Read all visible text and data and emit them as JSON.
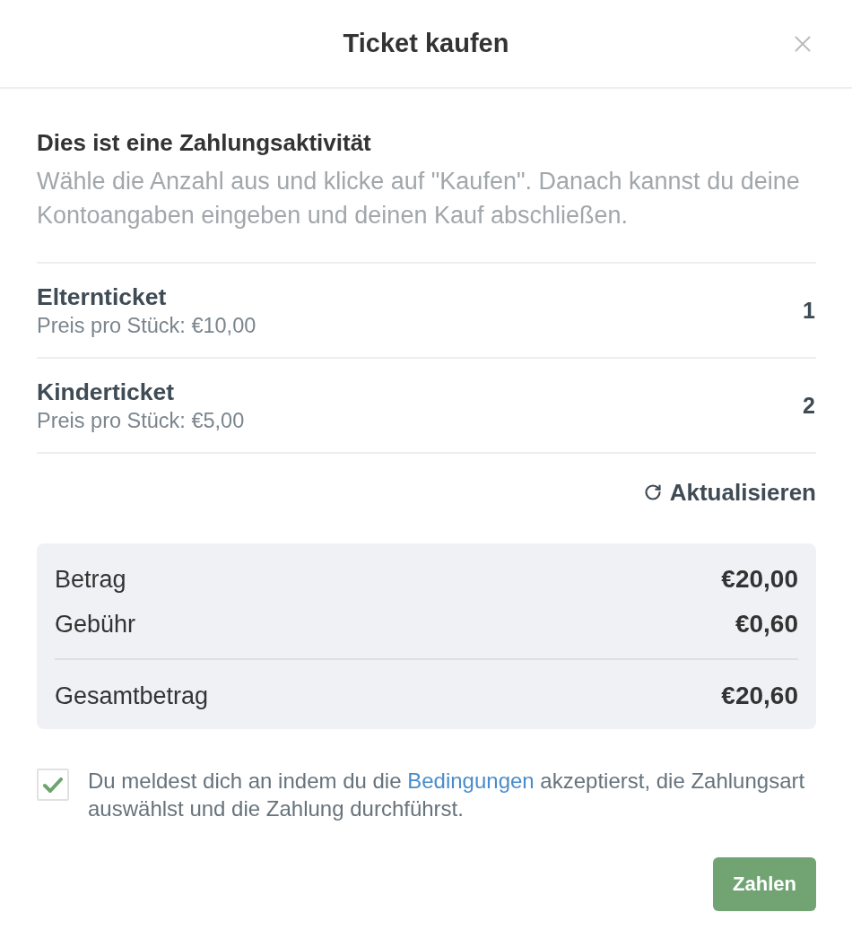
{
  "dialog": {
    "title": "Ticket kaufen"
  },
  "intro": {
    "heading": "Dies ist eine Zahlungsaktivität",
    "text": "Wähle die Anzahl aus und klicke auf \"Kaufen\". Danach kannst du deine Kontoangaben eingeben und deinen Kauf abschließen."
  },
  "tickets": [
    {
      "name": "Elternticket",
      "price": "Preis pro Stück: €10,00",
      "quantity": "1"
    },
    {
      "name": "Kinderticket",
      "price": "Preis pro Stück: €5,00",
      "quantity": "2"
    }
  ],
  "refresh_button": {
    "label": "Aktualisieren"
  },
  "summary": {
    "rows": [
      {
        "kind": "item",
        "label": "Betrag",
        "value": "€20,00"
      },
      {
        "kind": "item",
        "label": "Gebühr",
        "value": "€0,60"
      },
      {
        "kind": "total",
        "label": "Gesamtbetrag",
        "value": "€20,60"
      }
    ]
  },
  "consent": {
    "checked": true,
    "text_before": "Du meldest dich an indem du die ",
    "link": "Bedingungen",
    "text_after": " akzeptierst, die Zahlungsart auswählst und die Zahlung durchführst."
  },
  "pay_button": {
    "label": "Zahlen"
  }
}
